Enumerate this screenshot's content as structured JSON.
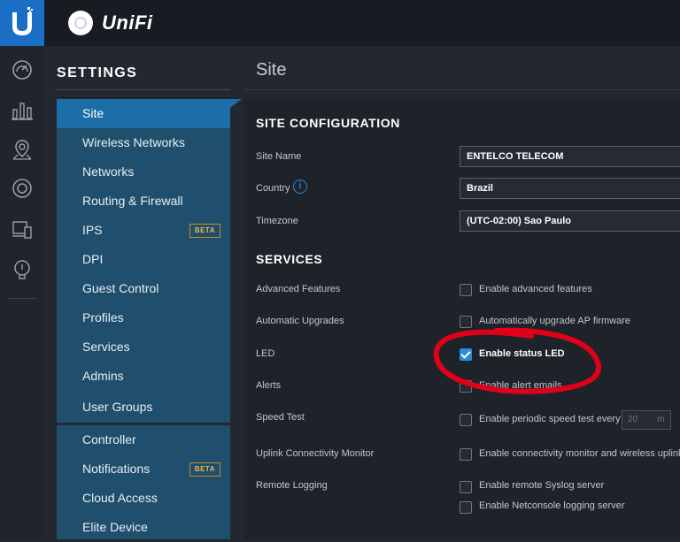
{
  "header": {
    "app_name": "UniFi",
    "logo_icon": "ubiquiti-logo-icon"
  },
  "rail": {
    "icons": [
      "dashboard-icon",
      "statistics-icon",
      "map-icon",
      "devices-icon",
      "clients-icon",
      "insights-icon"
    ]
  },
  "nav": {
    "title": "SETTINGS",
    "items": [
      {
        "label": "Site",
        "active": true
      },
      {
        "label": "Wireless Networks"
      },
      {
        "label": "Networks"
      },
      {
        "label": "Routing & Firewall"
      },
      {
        "label": "IPS",
        "badge": "BETA"
      },
      {
        "label": "DPI"
      },
      {
        "label": "Guest Control"
      },
      {
        "label": "Profiles"
      },
      {
        "label": "Services"
      },
      {
        "label": "Admins"
      },
      {
        "label": "User Groups"
      },
      {
        "label": "Controller"
      },
      {
        "label": "Notifications",
        "badge": "BETA"
      },
      {
        "label": "Cloud Access"
      },
      {
        "label": "Elite Device"
      }
    ]
  },
  "page": {
    "title": "Site"
  },
  "site_config": {
    "heading": "SITE CONFIGURATION",
    "site_name_label": "Site Name",
    "site_name_value": "ENTELCO TELECOM",
    "country_label": "Country",
    "country_value": "Brazil",
    "timezone_label": "Timezone",
    "timezone_value": "(UTC-02:00) Sao Paulo"
  },
  "services": {
    "heading": "SERVICES",
    "advanced_label": "Advanced Features",
    "advanced_cb": "Enable advanced features",
    "upgrades_label": "Automatic Upgrades",
    "upgrades_cb": "Automatically upgrade AP firmware",
    "led_label": "LED",
    "led_cb": "Enable status LED",
    "alerts_label": "Alerts",
    "alerts_cb": "Enable alert emails",
    "speed_label": "Speed Test",
    "speed_cb": "Enable periodic speed test every",
    "speed_value": "20",
    "speed_unit": "m",
    "uplink_label": "Uplink Connectivity Monitor",
    "uplink_cb": "Enable connectivity monitor and wireless uplink",
    "remote_label": "Remote Logging",
    "syslog_cb": "Enable remote Syslog server",
    "netconsole_cb": "Enable Netconsole logging server"
  },
  "colors": {
    "accent": "#1b6ea8",
    "nav_bg": "#1f4f6d",
    "highlight": "#e0001a",
    "badge": "#f0b64a"
  }
}
